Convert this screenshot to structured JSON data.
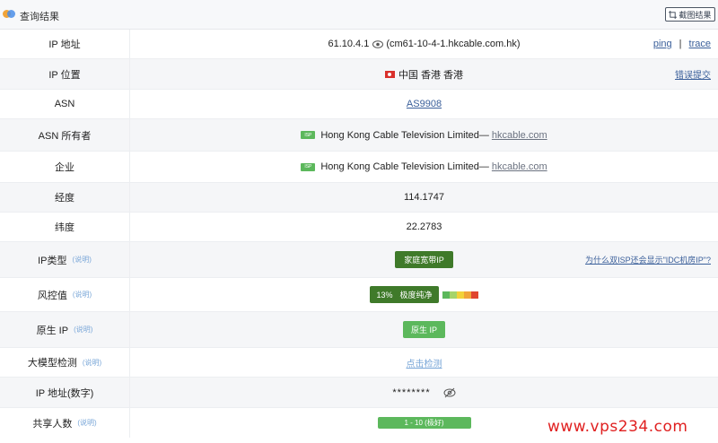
{
  "header": {
    "title": "查询结果",
    "screenshot_button": "截图结果",
    "logo_icon": "app-logo-icon"
  },
  "rows": {
    "ip_address": {
      "label": "IP 地址",
      "ip": "61.10.4.1",
      "hostname": "(cm61-10-4-1.hkcable.com.hk)",
      "ping": "ping",
      "separator": "|",
      "trace": "trace"
    },
    "ip_location": {
      "label": "IP 位置",
      "value": "中国 香港 香港",
      "report_link": "错误提交"
    },
    "asn": {
      "label": "ASN",
      "value": "AS9908"
    },
    "asn_owner": {
      "label": "ASN 所有者",
      "badge": "ISP",
      "name": "Hong Kong Cable Television Limited",
      "dash": "—",
      "domain": "hkcable.com"
    },
    "enterprise": {
      "label": "企业",
      "badge": "ISP",
      "name": "Hong Kong Cable Television Limited",
      "dash": "—",
      "domain": "hkcable.com"
    },
    "longitude": {
      "label": "经度",
      "value": "114.1747"
    },
    "latitude": {
      "label": "纬度",
      "value": "22.2783"
    },
    "ip_type": {
      "label": "IP类型",
      "note": "(说明)",
      "value": "家庭宽带IP",
      "help_link": "为什么双ISP还会显示\"IDC机房IP\"?"
    },
    "risk": {
      "label": "风控值",
      "note": "(说明)",
      "percent": "13%",
      "level": "极度纯净",
      "score_fraction": 0.13,
      "bar_colors": [
        "#5cb85c",
        "#a5d46a",
        "#f2d23a",
        "#f0a43a",
        "#e0452f"
      ]
    },
    "native_ip": {
      "label": "原生 IP",
      "note": "(说明)",
      "value": "原生 IP"
    },
    "ai_check": {
      "label": "大模型检测",
      "note": "(说明)",
      "value": "点击检测"
    },
    "ip_numeric": {
      "label": "IP 地址(数字)",
      "value": "********"
    },
    "shared_users": {
      "label": "共享人数",
      "note": "(说明)",
      "value": "1 - 10 (极好)"
    }
  },
  "watermark": "www.vps234.com",
  "colors": {
    "accent_green_dark": "#3f7a2a",
    "accent_green": "#5cb85c",
    "link_blue": "#3a5f9a",
    "watermark_red": "#e02020"
  }
}
